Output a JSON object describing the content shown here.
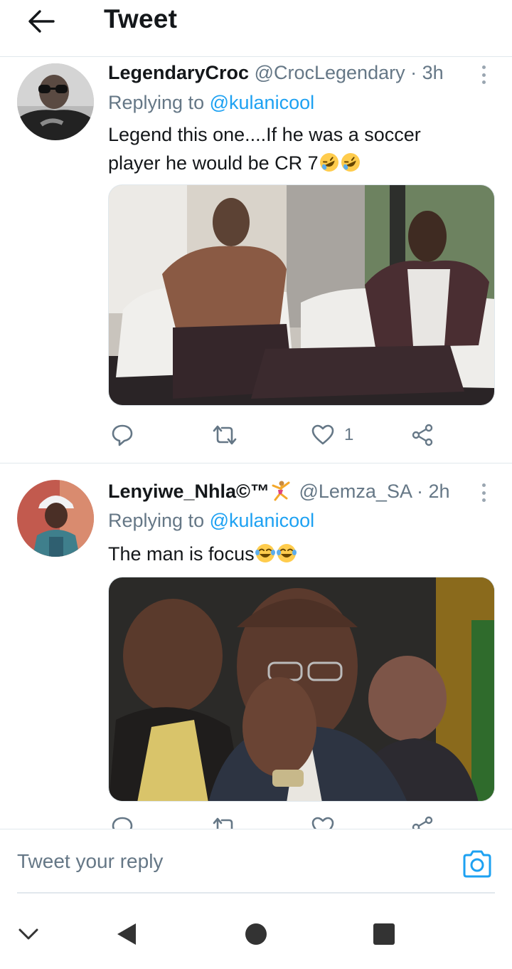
{
  "header": {
    "title": "Tweet"
  },
  "tweets": [
    {
      "name": "LegendaryCroc",
      "handle": "@CrocLegendary",
      "separator": "·",
      "time": "3h",
      "replying_prefix": "Replying to",
      "replying_to": "@kulanicool",
      "text": "Legend this one....If he was a soccer player he would be CR 7",
      "emojis": [
        "rofl-emoji",
        "rofl-emoji"
      ],
      "like_count": "1"
    },
    {
      "name": "Lenyiwe_Nhla©™",
      "handle": "@Lemza_SA",
      "separator": "·",
      "time": "2h",
      "replying_prefix": "Replying to",
      "replying_to": "@kulanicool",
      "text": "The man is focus",
      "emojis": [
        "joy-emoji",
        "joy-emoji"
      ],
      "like_count": ""
    }
  ],
  "composer": {
    "placeholder": "Tweet your reply"
  },
  "colors": {
    "accent": "#1da1f2",
    "secondary_text": "#657786",
    "divider": "#e1e8ed"
  },
  "icons": [
    "back-arrow-icon",
    "more-vertical-icon",
    "reply-icon",
    "retweet-icon",
    "like-icon",
    "share-icon",
    "camera-icon",
    "chevron-down-icon",
    "nav-back-icon",
    "nav-home-icon",
    "nav-recents-icon"
  ]
}
